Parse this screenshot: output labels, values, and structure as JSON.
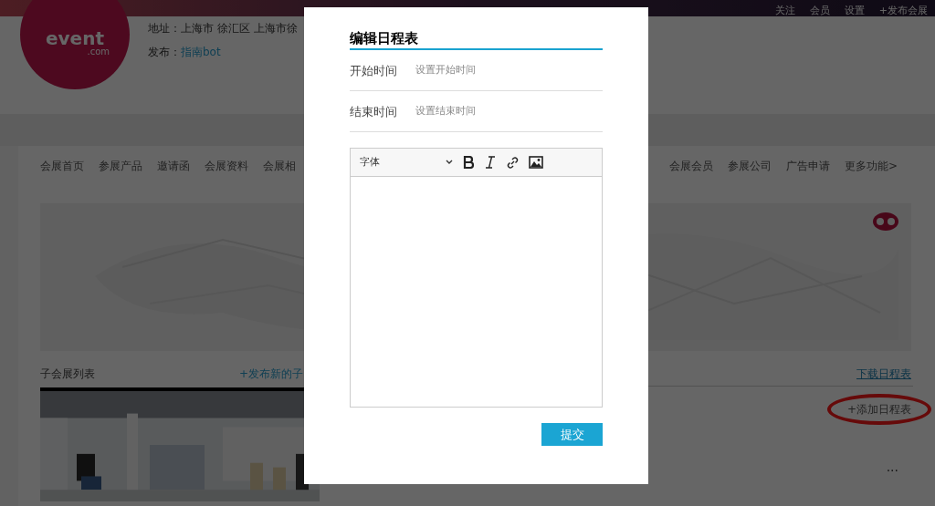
{
  "top_bar": {
    "links": [
      "关注",
      "会员",
      "设置",
      "+发布会展"
    ]
  },
  "logo": {
    "word": "event",
    "domain": ".com"
  },
  "info": {
    "address_label": "地址：",
    "address": "上海市 徐汇区 上海市徐",
    "publisher_label": "发布：",
    "publisher": "指南bot"
  },
  "nav_left": [
    "会展首页",
    "参展产品",
    "邀请函",
    "会展资料",
    "会展相"
  ],
  "nav_right": [
    "会展会员",
    "参展公司",
    "广告申请",
    "更多功能>"
  ],
  "banner": {
    "kind": "picture"
  },
  "sub_list": {
    "title": "子会展列表",
    "publish_link": "+发布新的子"
  },
  "schedule": {
    "download_link": "下载日程表",
    "add_link": "+添加日程表",
    "add_highlighted": true,
    "more": "..."
  },
  "modal": {
    "title": "编辑日程表",
    "fields": [
      {
        "label": "开始时间",
        "placeholder": "设置开始时间"
      },
      {
        "label": "结束时间",
        "placeholder": "设置结束时间"
      }
    ],
    "editor": {
      "font_select": "字体"
    },
    "submit": "提交"
  }
}
